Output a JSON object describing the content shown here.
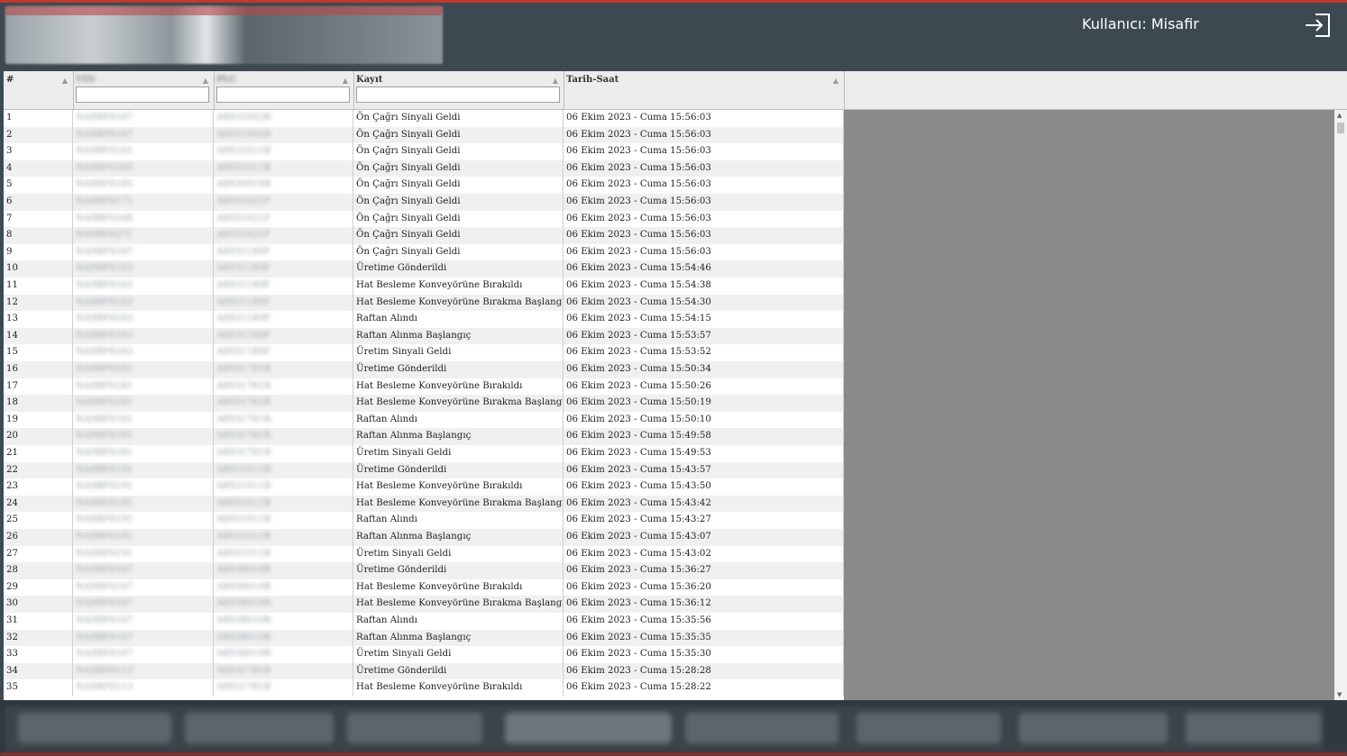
{
  "header": {
    "user_label": "Kullanıcı: Misafir",
    "logout_icon": "logout-icon"
  },
  "table": {
    "columns": [
      {
        "label": "#",
        "filter": false
      },
      {
        "label": "VIN",
        "filter": true
      },
      {
        "label": "PLC",
        "filter": true
      },
      {
        "label": "Kayıt",
        "filter": true
      },
      {
        "label": "Tarih-Saat",
        "filter": false
      }
    ],
    "rows": [
      {
        "no": "1",
        "vin": "NA9RF6167",
        "plc": "A8931002B",
        "kayit": "Ön Çağrı Sinyali Geldi",
        "tarih": "06 Ekim 2023 - Cuma 15:56:03"
      },
      {
        "no": "2",
        "vin": "NA9RF6187",
        "plc": "A8931002B",
        "kayit": "Ön Çağrı Sinyali Geldi",
        "tarih": "06 Ekim 2023 - Cuma 15:56:03"
      },
      {
        "no": "3",
        "vin": "NA9RF6161",
        "plc": "A8931011B",
        "kayit": "Ön Çağrı Sinyali Geldi",
        "tarih": "06 Ekim 2023 - Cuma 15:56:03"
      },
      {
        "no": "4",
        "vin": "NA9RF6165",
        "plc": "A8931011B",
        "kayit": "Ön Çağrı Sinyali Geldi",
        "tarih": "06 Ekim 2023 - Cuma 15:56:03"
      },
      {
        "no": "5",
        "vin": "NA9RF6185",
        "plc": "A8930010B",
        "kayit": "Ön Çağrı Sinyali Geldi",
        "tarih": "06 Ekim 2023 - Cuma 15:56:03"
      },
      {
        "no": "6",
        "vin": "NA9RF6171",
        "plc": "A8931021F",
        "kayit": "Ön Çağrı Sinyali Geldi",
        "tarih": "06 Ekim 2023 - Cuma 15:56:03"
      },
      {
        "no": "7",
        "vin": "NA9RF6168",
        "plc": "A8931021F",
        "kayit": "Ön Çağrı Sinyali Geldi",
        "tarih": "06 Ekim 2023 - Cuma 15:56:03"
      },
      {
        "no": "8",
        "vin": "NA9RF6271",
        "plc": "A8931021F",
        "kayit": "Ön Çağrı Sinyali Geldi",
        "tarih": "06 Ekim 2023 - Cuma 15:56:03"
      },
      {
        "no": "9",
        "vin": "NA9RF6167",
        "plc": "A8931180F",
        "kayit": "Ön Çağrı Sinyali Geldi",
        "tarih": "06 Ekim 2023 - Cuma 15:56:03"
      },
      {
        "no": "10",
        "vin": "NA9RF6163",
        "plc": "A8931180F",
        "kayit": "Üretime Gönderildi",
        "tarih": "06 Ekim 2023 - Cuma 15:54:46"
      },
      {
        "no": "11",
        "vin": "NA9RF6163",
        "plc": "A8931180F",
        "kayit": "Hat Besleme Konveyörüne Bırakıldı",
        "tarih": "06 Ekim 2023 - Cuma 15:54:38"
      },
      {
        "no": "12",
        "vin": "NA9RF6163",
        "plc": "A8931180F",
        "kayit": "Hat Besleme Konveyörüne Bırakma Başlangıç",
        "tarih": "06 Ekim 2023 - Cuma 15:54:30"
      },
      {
        "no": "13",
        "vin": "NA9RF6163",
        "plc": "A8931180F",
        "kayit": "Raftan Alındı",
        "tarih": "06 Ekim 2023 - Cuma 15:54:15"
      },
      {
        "no": "14",
        "vin": "NA9RF6163",
        "plc": "A8931180F",
        "kayit": "Raftan Alınma Başlangıç",
        "tarih": "06 Ekim 2023 - Cuma 15:53:57"
      },
      {
        "no": "15",
        "vin": "NA9RF6163",
        "plc": "A8931180F",
        "kayit": "Üretim Sinyali Geldi",
        "tarih": "06 Ekim 2023 - Cuma 15:53:52"
      },
      {
        "no": "16",
        "vin": "NA9RF6181",
        "plc": "A8931781B",
        "kayit": "Üretime Gönderildi",
        "tarih": "06 Ekim 2023 - Cuma 15:50:34"
      },
      {
        "no": "17",
        "vin": "NA9RF6181",
        "plc": "A8931781B",
        "kayit": "Hat Besleme Konveyörüne Bırakıldı",
        "tarih": "06 Ekim 2023 - Cuma 15:50:26"
      },
      {
        "no": "18",
        "vin": "NA9RF6181",
        "plc": "A8931781B",
        "kayit": "Hat Besleme Konveyörüne Bırakma Başlangıç",
        "tarih": "06 Ekim 2023 - Cuma 15:50:19"
      },
      {
        "no": "19",
        "vin": "NA9RF6181",
        "plc": "A8931781B",
        "kayit": "Raftan Alındı",
        "tarih": "06 Ekim 2023 - Cuma 15:50:10"
      },
      {
        "no": "20",
        "vin": "NA9RF6181",
        "plc": "A8931781B",
        "kayit": "Raftan Alınma Başlangıç",
        "tarih": "06 Ekim 2023 - Cuma 15:49:58"
      },
      {
        "no": "21",
        "vin": "NA9RF6181",
        "plc": "A8931781B",
        "kayit": "Üretim Sinyali Geldi",
        "tarih": "06 Ekim 2023 - Cuma 15:49:53"
      },
      {
        "no": "22",
        "vin": "NA9RF6191",
        "plc": "A8931011B",
        "kayit": "Üretime Gönderildi",
        "tarih": "06 Ekim 2023 - Cuma 15:43:57"
      },
      {
        "no": "23",
        "vin": "NA9RF6191",
        "plc": "A8931011B",
        "kayit": "Hat Besleme Konveyörüne Bırakıldı",
        "tarih": "06 Ekim 2023 - Cuma 15:43:50"
      },
      {
        "no": "24",
        "vin": "NA9RF6191",
        "plc": "A8931011B",
        "kayit": "Hat Besleme Konveyörüne Bırakma Başlangıç",
        "tarih": "06 Ekim 2023 - Cuma 15:43:42"
      },
      {
        "no": "25",
        "vin": "NA9RF6191",
        "plc": "A8931011B",
        "kayit": "Raftan Alındı",
        "tarih": "06 Ekim 2023 - Cuma 15:43:27"
      },
      {
        "no": "26",
        "vin": "NA9RF6191",
        "plc": "A8931011B",
        "kayit": "Raftan Alınma Başlangıç",
        "tarih": "06 Ekim 2023 - Cuma 15:43:07"
      },
      {
        "no": "27",
        "vin": "NA9RF6191",
        "plc": "A8931011B",
        "kayit": "Üretim Sinyali Geldi",
        "tarih": "06 Ekim 2023 - Cuma 15:43:02"
      },
      {
        "no": "28",
        "vin": "NA9RF6167",
        "plc": "A8938010B",
        "kayit": "Üretime Gönderildi",
        "tarih": "06 Ekim 2023 - Cuma 15:36:27"
      },
      {
        "no": "29",
        "vin": "NA9RF6167",
        "plc": "A8938010B",
        "kayit": "Hat Besleme Konveyörüne Bırakıldı",
        "tarih": "06 Ekim 2023 - Cuma 15:36:20"
      },
      {
        "no": "30",
        "vin": "NA9RF6167",
        "plc": "A8938010B",
        "kayit": "Hat Besleme Konveyörüne Bırakma Başlangıç",
        "tarih": "06 Ekim 2023 - Cuma 15:36:12"
      },
      {
        "no": "31",
        "vin": "NA9RF6167",
        "plc": "A8938010B",
        "kayit": "Raftan Alındı",
        "tarih": "06 Ekim 2023 - Cuma 15:35:56"
      },
      {
        "no": "32",
        "vin": "NA9RF6167",
        "plc": "A8938010B",
        "kayit": "Raftan Alınma Başlangıç",
        "tarih": "06 Ekim 2023 - Cuma 15:35:35"
      },
      {
        "no": "33",
        "vin": "NA9RF6167",
        "plc": "A8938010B",
        "kayit": "Üretim Sinyali Geldi",
        "tarih": "06 Ekim 2023 - Cuma 15:35:30"
      },
      {
        "no": "34",
        "vin": "NA9RF6113",
        "plc": "A8931781B",
        "kayit": "Üretime Gönderildi",
        "tarih": "06 Ekim 2023 - Cuma 15:28:28"
      },
      {
        "no": "35",
        "vin": "NA9RF6113",
        "plc": "A8931781B",
        "kayit": "Hat Besleme Konveyörüne Bırakıldı",
        "tarih": "06 Ekim 2023 - Cuma 15:28:22"
      }
    ]
  },
  "colors": {
    "header_bg": "#3c4950",
    "accent_red": "#c0392b",
    "grid_empty": "#8a8a8a"
  }
}
